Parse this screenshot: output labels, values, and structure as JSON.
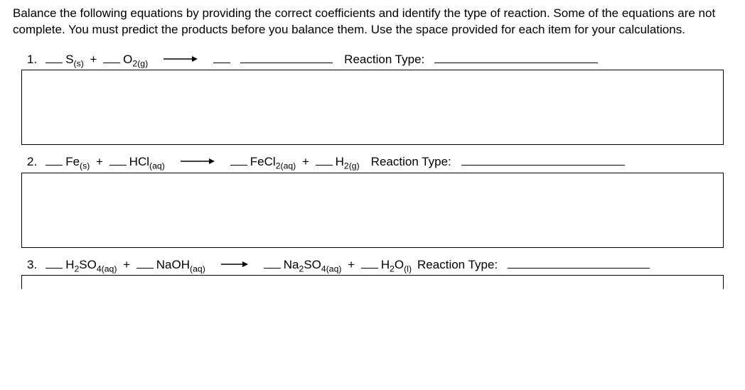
{
  "instructions": "Balance the following equations by providing the correct coefficients and identify the type of reaction. Some of the equations are not complete. You must predict the products before you balance them. Use the space provided for each item for your calculations.",
  "reactionTypeLabel": "Reaction Type:",
  "items": [
    {
      "num": "1.",
      "reactants": [
        {
          "formula": "S",
          "state": "(s)"
        },
        {
          "formula": "O2",
          "state": "(g)"
        }
      ],
      "products": [],
      "blankProduct": true
    },
    {
      "num": "2.",
      "reactants": [
        {
          "formula": "Fe",
          "state": "(s)"
        },
        {
          "formula": "HCl",
          "state": "(aq)"
        }
      ],
      "products": [
        {
          "formula": "FeCl2",
          "state": "(aq)"
        },
        {
          "formula": "H2",
          "state": "(g)"
        }
      ],
      "blankProduct": false
    },
    {
      "num": "3.",
      "reactants": [
        {
          "formula": "H2SO4",
          "state": "(aq)"
        },
        {
          "formula": "NaOH",
          "state": "(aq)"
        }
      ],
      "products": [
        {
          "formula": "Na2SO4",
          "state": "(aq)"
        },
        {
          "formula": "H2O",
          "state": "(l)"
        }
      ],
      "blankProduct": false
    }
  ]
}
